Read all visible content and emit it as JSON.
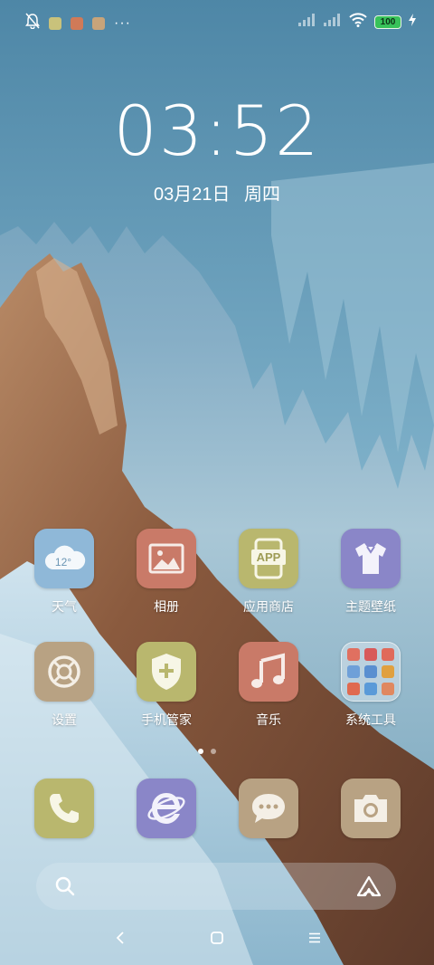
{
  "status_bar": {
    "left_icons": [
      "bell-off-icon",
      "app-notification-icon",
      "app-notification-icon",
      "app-notification-icon"
    ],
    "more_indicator": "···",
    "battery_level": "100",
    "right_icons": [
      "no-signal-icon",
      "no-signal-icon",
      "wifi-icon",
      "battery-icon",
      "charging-icon"
    ]
  },
  "lockclock": {
    "time": "03:52",
    "date": "03月21日  周四"
  },
  "apps": [
    {
      "label": "天气",
      "icon": "weather-icon",
      "temp": "12°",
      "color": "#8fb8d8"
    },
    {
      "label": "相册",
      "icon": "gallery-icon",
      "color": "#c97a68"
    },
    {
      "label": "应用商店",
      "icon": "app-store-icon",
      "badge": "APP",
      "color": "#b9b76e"
    },
    {
      "label": "主题壁纸",
      "icon": "theme-shirt-icon",
      "color": "#8a86c8"
    },
    {
      "label": "设置",
      "icon": "settings-icon",
      "color": "#b8a283"
    },
    {
      "label": "手机管家",
      "icon": "security-shield-icon",
      "color": "#b9b76e"
    },
    {
      "label": "音乐",
      "icon": "music-icon",
      "color": "#c97a68"
    },
    {
      "label": "系统工具",
      "icon": "folder-icon",
      "color": "#dbe6ee"
    }
  ],
  "dock": [
    {
      "name": "phone",
      "icon": "phone-icon",
      "color": "#b9b76e"
    },
    {
      "name": "browser",
      "icon": "browser-icon",
      "color": "#8a86c8"
    },
    {
      "name": "messages",
      "icon": "message-icon",
      "color": "#b8a283"
    },
    {
      "name": "camera",
      "icon": "camera-icon",
      "color": "#b8a283"
    }
  ],
  "pages": {
    "count": 2,
    "current": 1
  },
  "search": {
    "icon": "search-icon",
    "assistant_icon": "assistant-icon"
  },
  "nav": {
    "back": "back-icon",
    "home": "home-icon",
    "menu": "menu-icon"
  }
}
